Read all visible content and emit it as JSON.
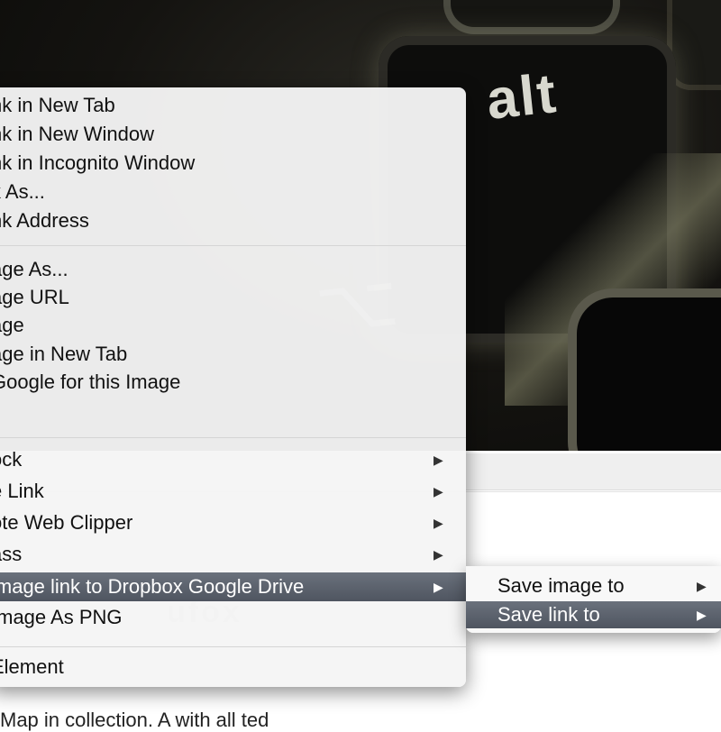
{
  "background": {
    "key_label": "alt",
    "page_watermark": "ufox",
    "page_text": "Map in collection. A with all ted"
  },
  "context_menu": {
    "groups": [
      [
        "nk in New Tab",
        "nk in New Window",
        "nk in Incognito Window",
        "k As...",
        "nk Address"
      ],
      [
        "age As...",
        "age URL",
        "age",
        "age in New Tab",
        "Google for this Image"
      ],
      [
        "ock",
        "e Link",
        "ote Web Clipper",
        "ass",
        "image  link to Dropbox  Google Drive",
        "Image As PNG"
      ],
      [
        "Element"
      ]
    ],
    "submenu_arrow": "▶",
    "highlighted_item": "image  link to Dropbox  Google Drive"
  },
  "submenu": {
    "items": [
      "Save image to",
      "Save link to"
    ],
    "highlighted_item": "Save link to"
  },
  "colors": {
    "highlight": "#5c636e",
    "menu_bg": "#f5f5f5"
  }
}
